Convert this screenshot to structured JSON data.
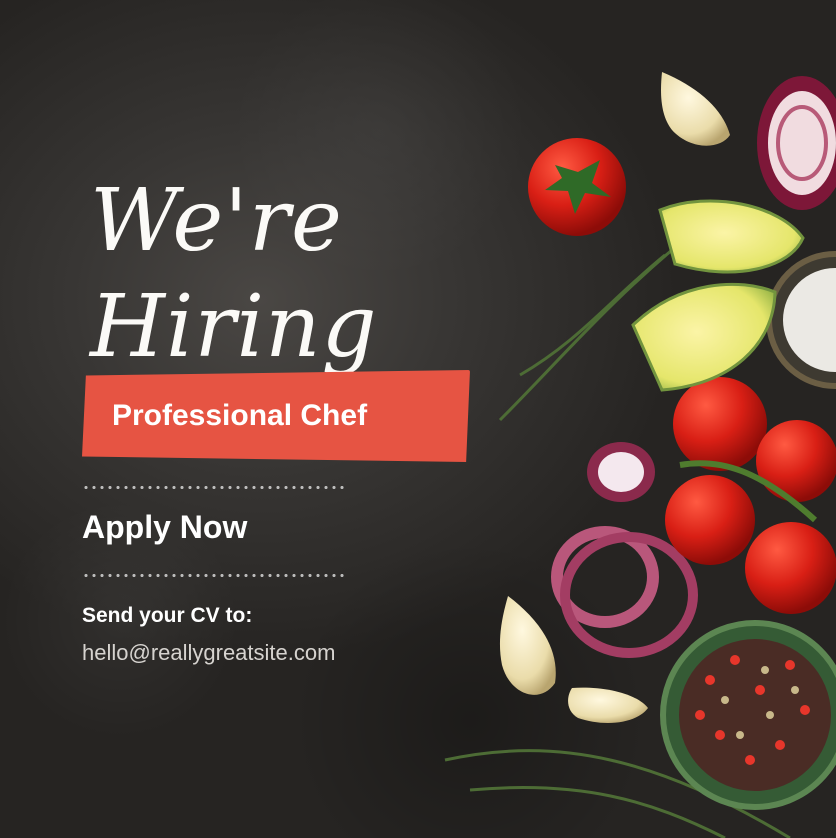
{
  "poster": {
    "headline_line_1": "We're",
    "headline_line_2": "Hiring",
    "role": "Professional Chef",
    "apply_label": "Apply Now",
    "contact_label": "Send your CV to:",
    "email": "hello@reallygreatsite.com"
  },
  "colors": {
    "background": "#2a2826",
    "banner": "#e65443",
    "text": "#ffffff",
    "email_text": "#d6d3cf"
  },
  "decorations": [
    "tomato-icon",
    "garlic-icon",
    "lime-slice-icon",
    "red-onion-icon",
    "peppercorn-bowl-icon",
    "herb-sprig-icon",
    "salt-bowl-icon"
  ]
}
